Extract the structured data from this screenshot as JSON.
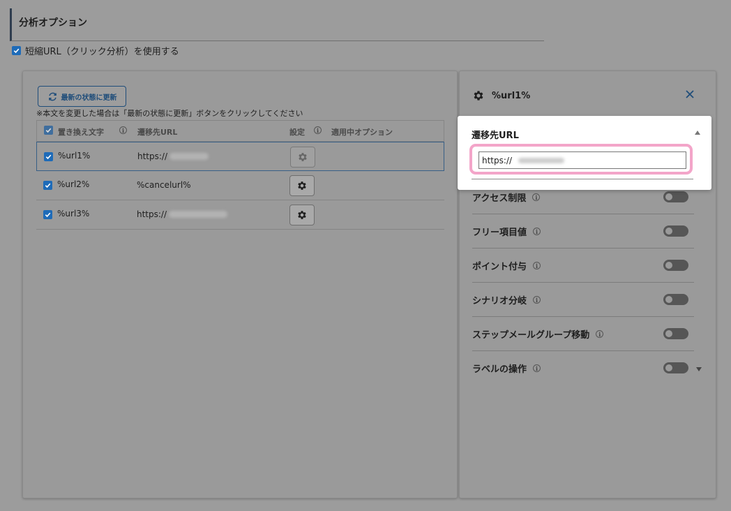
{
  "section": {
    "title": "分析オプション"
  },
  "shorten": {
    "label": "短縮URL（クリック分析）を使用する",
    "checked": true
  },
  "left": {
    "refresh_label": "最新の状態に更新",
    "note": "※本文を変更した場合は「最新の状態に更新」ボタンをクリックしてください",
    "headers": {
      "replace": "置き換え文字",
      "dest": "遷移先URL",
      "settings": "設定",
      "applied": "適用中オプション"
    },
    "rows": [
      {
        "name": "%url1%",
        "url": "https://"
      },
      {
        "name": "%url2%",
        "url": "%cancelurl%"
      },
      {
        "name": "%url3%",
        "url": "https://"
      }
    ]
  },
  "right": {
    "title": "%url1%",
    "dest_label": "遷移先URL",
    "dest_value": "https://",
    "options": [
      {
        "label": "アクセス制限"
      },
      {
        "label": "フリー項目値"
      },
      {
        "label": "ポイント付与"
      },
      {
        "label": "シナリオ分岐"
      },
      {
        "label": "ステップメールグループ移動"
      },
      {
        "label": "ラベルの操作"
      }
    ]
  },
  "icons": {
    "refresh": "refresh-icon",
    "gear": "gear-icon",
    "close": "close-icon",
    "info": "info-icon"
  },
  "colors": {
    "accent": "#1e6bb8",
    "highlight": "#f3a5c9"
  }
}
